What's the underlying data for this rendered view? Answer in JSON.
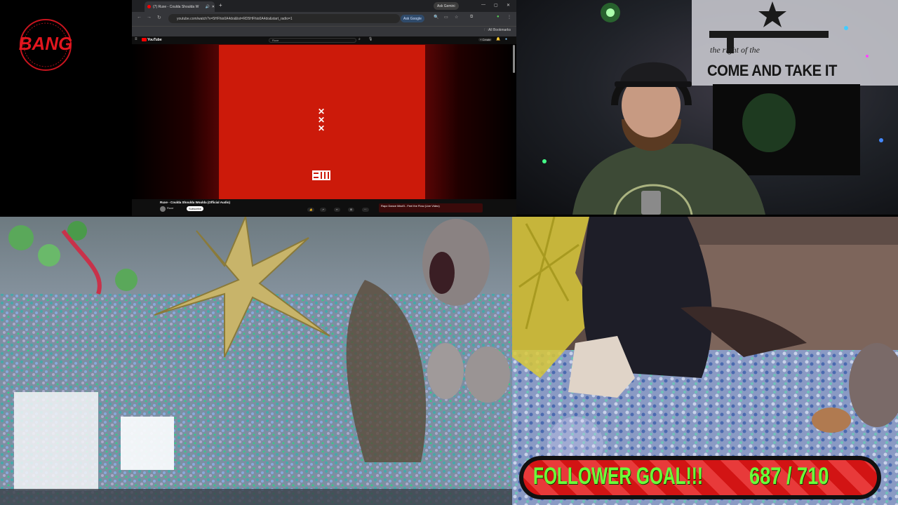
{
  "logo": {
    "text": "BANG"
  },
  "browser": {
    "tab_title": "(7) Ruxe - Coulda Shoulda W",
    "ask_gemini": "Ask Gemini",
    "url": "youtube.com/watch?v=5HFhio0A4do&list=RD5HFhio0A4do&start_radio=1",
    "ask_google": "Ask Google",
    "all_bookmarks": "All Bookmarks",
    "youtube": {
      "logo_text": "YouTube",
      "search_value": "Ruxe",
      "create_label": "+ Create",
      "video_title": "Ruxe - Coulda Shoulda Woulda (Official Audio)",
      "channel": "Ruxe",
      "subscribe_label": "Subscribe",
      "next_card": "Rapz Dance Mix#3 - Feel the Flow (Live Video)"
    }
  },
  "webcam": {
    "flag_slogan": "COME AND TAKE IT",
    "flag_line2": "the right of the"
  },
  "follower_goal": {
    "label": "FOLLOWER GOAL!!!",
    "count": "687 / 710",
    "current": 687,
    "target": 710
  },
  "colors": {
    "goal_text": "#6bff3a",
    "goal_stripe": "#d21414",
    "album_red": "#cc1a0a"
  }
}
